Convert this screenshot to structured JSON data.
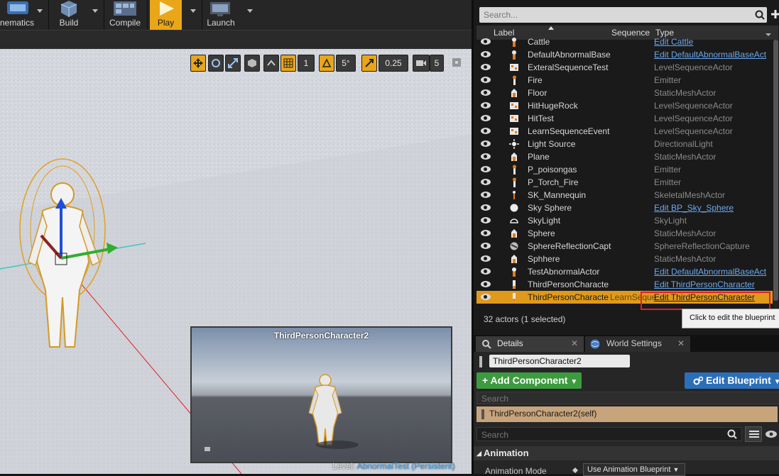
{
  "toolbar": {
    "cinematics_label": "nematics",
    "build_label": "Build",
    "compile_label": "Compile",
    "play_label": "Play",
    "launch_label": "Launch"
  },
  "viewport": {
    "snap_grid": "1",
    "rotation_snap": "5°",
    "scale_snap": "0.25",
    "camera_speed": "5",
    "inset_title": "ThirdPersonCharacter2",
    "level_prefix": "Level:",
    "level_name": "AbnormalTest (Persistent)"
  },
  "outliner": {
    "search_placeholder": "Search...",
    "col_label": "Label",
    "col_sequence": "Sequence",
    "col_type": "Type",
    "rows": [
      {
        "label": "Cattle",
        "type": "Edit Cattle",
        "link": true,
        "icon": "actor-icon"
      },
      {
        "label": "DefaultAbnormalBase",
        "type": "Edit DefaultAbnormalBaseAct",
        "link": true,
        "icon": "actor-icon"
      },
      {
        "label": "ExteralSequenceTest",
        "type": "LevelSequenceActor",
        "link": false,
        "icon": "sequence-icon"
      },
      {
        "label": "Fire",
        "type": "Emitter",
        "link": false,
        "icon": "emitter-icon"
      },
      {
        "label": "Floor",
        "type": "StaticMeshActor",
        "link": false,
        "icon": "mesh-icon"
      },
      {
        "label": "HitHugeRock",
        "type": "LevelSequenceActor",
        "link": false,
        "icon": "sequence-icon"
      },
      {
        "label": "HitTest",
        "type": "LevelSequenceActor",
        "link": false,
        "icon": "sequence-icon"
      },
      {
        "label": "LearnSequenceEvent",
        "type": "LevelSequenceActor",
        "link": false,
        "icon": "sequence-icon"
      },
      {
        "label": "Light Source",
        "type": "DirectionalLight",
        "link": false,
        "icon": "light-icon"
      },
      {
        "label": "Plane",
        "type": "StaticMeshActor",
        "link": false,
        "icon": "mesh-icon"
      },
      {
        "label": "P_poisongas",
        "type": "Emitter",
        "link": false,
        "icon": "emitter-icon"
      },
      {
        "label": "P_Torch_Fire",
        "type": "Emitter",
        "link": false,
        "icon": "emitter-icon"
      },
      {
        "label": "SK_Mannequin",
        "type": "SkeletalMeshActor",
        "link": false,
        "icon": "skeletal-icon"
      },
      {
        "label": "Sky Sphere",
        "type": "Edit BP_Sky_Sphere",
        "link": true,
        "icon": "sphere-icon"
      },
      {
        "label": "SkyLight",
        "type": "SkyLight",
        "link": false,
        "icon": "skylight-icon"
      },
      {
        "label": "Sphere",
        "type": "StaticMeshActor",
        "link": false,
        "icon": "mesh-icon"
      },
      {
        "label": "SphereReflectionCapt",
        "type": "SphereReflectionCapture",
        "link": false,
        "icon": "reflection-icon"
      },
      {
        "label": "Sphhere",
        "type": "StaticMeshActor",
        "link": false,
        "icon": "mesh-icon"
      },
      {
        "label": "TestAbnormalActor",
        "type": "Edit DefaultAbnormalBaseAct",
        "link": true,
        "icon": "actor-icon"
      },
      {
        "label": "ThirdPersonCharacte",
        "type": "Edit ThirdPersonCharacter",
        "link": true,
        "icon": "character-icon"
      },
      {
        "label": "ThirdPersonCharacte",
        "sequence": "LearnSeque",
        "type": "Edit ThirdPersonCharacter",
        "link": true,
        "icon": "character-icon",
        "selected": true
      }
    ],
    "actor_count": "32 actors (1 selected)",
    "tooltip": "Click to edit the blueprint"
  },
  "details": {
    "tab_details": "Details",
    "tab_world": "World Settings",
    "name": "ThirdPersonCharacter2",
    "add_component": "+ Add Component",
    "edit_blueprint": "Edit Blueprint",
    "component_search": "Search",
    "self_row": "ThirdPersonCharacter2(self)",
    "details_search": "Search",
    "section_animation": "Animation",
    "anim_mode_label": "Animation Mode",
    "anim_mode_value": "Use Animation Blueprint"
  },
  "colors": {
    "accent": "#e09a1b",
    "link": "#6aa8f0",
    "add_green": "#3d9b3f",
    "edit_blue": "#2c6fb8",
    "highlight_red": "#e0202a"
  }
}
